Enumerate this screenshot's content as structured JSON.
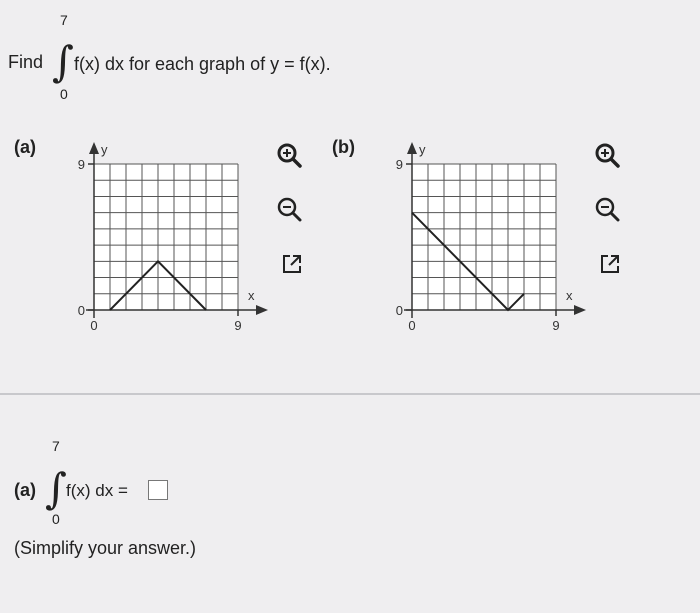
{
  "question": {
    "prefix": "Find",
    "upper_limit": "7",
    "lower_limit": "0",
    "integrand": "f(x) dx for each graph of y = f(x)."
  },
  "graphs": [
    {
      "label": "(a)",
      "y_axis_label": "y",
      "x_axis_label": "x",
      "y_max_label": "9",
      "y_zero_label": "0",
      "x_zero_label": "0",
      "x_max_label": "9"
    },
    {
      "label": "(b)",
      "y_axis_label": "y",
      "x_axis_label": "x",
      "y_max_label": "9",
      "y_zero_label": "0",
      "x_zero_label": "0",
      "x_max_label": "9"
    }
  ],
  "chart_data": [
    {
      "type": "line",
      "title": "(a)",
      "xlabel": "x",
      "ylabel": "y",
      "xlim": [
        0,
        9
      ],
      "ylim": [
        0,
        9
      ],
      "grid": true,
      "series": [
        {
          "x": [
            1,
            4,
            7
          ],
          "y": [
            0,
            3,
            0
          ]
        }
      ]
    },
    {
      "type": "line",
      "title": "(b)",
      "xlabel": "x",
      "ylabel": "y",
      "xlim": [
        0,
        9
      ],
      "ylim": [
        0,
        9
      ],
      "grid": true,
      "series": [
        {
          "x": [
            0,
            6,
            7
          ],
          "y": [
            6,
            0,
            1
          ]
        }
      ]
    }
  ],
  "tools": {
    "zoom_in_icon": "magnifier-plus",
    "zoom_out_icon": "magnifier-minus",
    "open_icon": "external-link"
  },
  "answer": {
    "label": "(a)",
    "upper_limit": "7",
    "lower_limit": "0",
    "integrand": "f(x) dx =",
    "hint": "(Simplify your answer.)"
  }
}
